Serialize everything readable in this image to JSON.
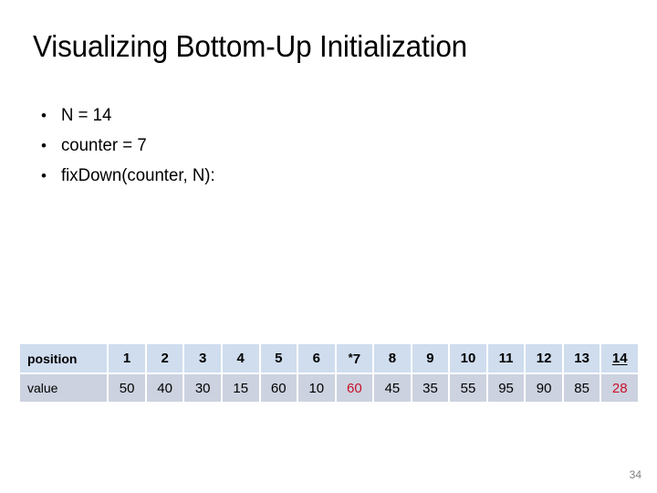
{
  "slide": {
    "title": "Visualizing Bottom-Up Initialization",
    "page_number": "34",
    "bullets": [
      {
        "marker": "•",
        "text": "N = 14"
      },
      {
        "marker": "•",
        "text": "counter = 7"
      },
      {
        "marker": "•",
        "text": "fixDown(counter, N):"
      }
    ]
  },
  "table": {
    "row_labels": {
      "position": "position",
      "value": "value"
    },
    "positions": [
      {
        "label": "1",
        "star": false,
        "underline": false
      },
      {
        "label": "2",
        "star": false,
        "underline": false
      },
      {
        "label": "3",
        "star": false,
        "underline": false
      },
      {
        "label": "4",
        "star": false,
        "underline": false
      },
      {
        "label": "5",
        "star": false,
        "underline": false
      },
      {
        "label": "6",
        "star": false,
        "underline": false
      },
      {
        "label": "7",
        "star": true,
        "underline": false
      },
      {
        "label": "8",
        "star": false,
        "underline": false
      },
      {
        "label": "9",
        "star": false,
        "underline": false
      },
      {
        "label": "10",
        "star": false,
        "underline": false
      },
      {
        "label": "11",
        "star": false,
        "underline": false
      },
      {
        "label": "12",
        "star": false,
        "underline": false
      },
      {
        "label": "13",
        "star": false,
        "underline": false
      },
      {
        "label": "14",
        "star": false,
        "underline": true
      }
    ],
    "values": [
      {
        "label": "50",
        "highlight": false
      },
      {
        "label": "40",
        "highlight": false
      },
      {
        "label": "30",
        "highlight": false
      },
      {
        "label": "15",
        "highlight": false
      },
      {
        "label": "60",
        "highlight": false
      },
      {
        "label": "10",
        "highlight": false
      },
      {
        "label": "60",
        "highlight": true
      },
      {
        "label": "45",
        "highlight": false
      },
      {
        "label": "35",
        "highlight": false
      },
      {
        "label": "55",
        "highlight": false
      },
      {
        "label": "95",
        "highlight": false
      },
      {
        "label": "90",
        "highlight": false
      },
      {
        "label": "85",
        "highlight": false
      },
      {
        "label": "28",
        "highlight": true
      }
    ],
    "star_symbol": "*",
    "colors": {
      "header_background": "#cfddee",
      "value_background": "#ccd2df",
      "highlight_text": "#c9102a",
      "text": "#000000"
    }
  }
}
